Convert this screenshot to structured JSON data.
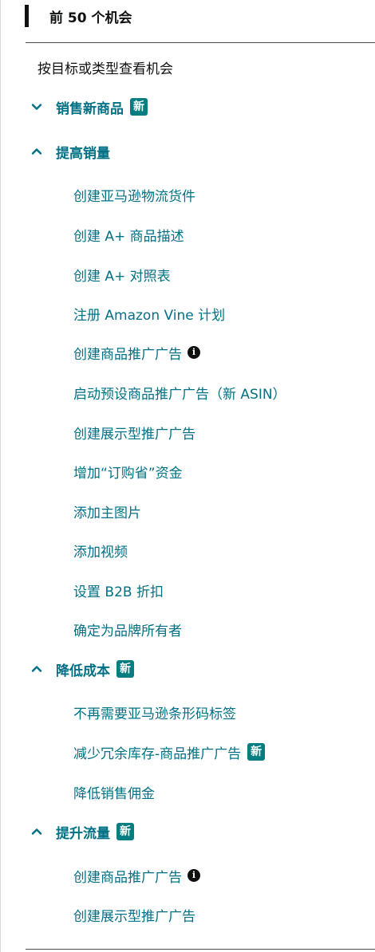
{
  "header": {
    "title": "前 50 个机会"
  },
  "subtitle": "按目标或类型查看机会",
  "badge_label": "新",
  "colors": {
    "link": "#007185",
    "badge": "#067d80",
    "text": "#0f1111"
  },
  "sections": [
    {
      "label": "销售新商品",
      "expanded": false,
      "badge": true,
      "items": []
    },
    {
      "label": "提高销量",
      "expanded": true,
      "badge": false,
      "items": [
        {
          "label": "创建亚马逊物流货件"
        },
        {
          "label": "创建 A+ 商品描述"
        },
        {
          "label": "创建 A+ 对照表"
        },
        {
          "label": "注册 Amazon Vine 计划"
        },
        {
          "label": "创建商品推广广告",
          "info": true
        },
        {
          "label": "启动预设商品推广广告（新 ASIN）"
        },
        {
          "label": "创建展示型推广广告"
        },
        {
          "label": "增加“订购省”资金"
        },
        {
          "label": "添加主图片"
        },
        {
          "label": "添加视频"
        },
        {
          "label": "设置 B2B 折扣"
        },
        {
          "label": "确定为品牌所有者"
        }
      ]
    },
    {
      "label": "降低成本",
      "expanded": true,
      "badge": true,
      "items": [
        {
          "label": "不再需要亚马逊条形码标签"
        },
        {
          "label": "减少冗余库存-商品推广广告",
          "badge": true
        },
        {
          "label": "降低销售佣金"
        }
      ]
    },
    {
      "label": "提升流量",
      "expanded": true,
      "badge": true,
      "items": [
        {
          "label": "创建商品推广广告",
          "info": true
        },
        {
          "label": "创建展示型推广广告"
        }
      ]
    }
  ]
}
